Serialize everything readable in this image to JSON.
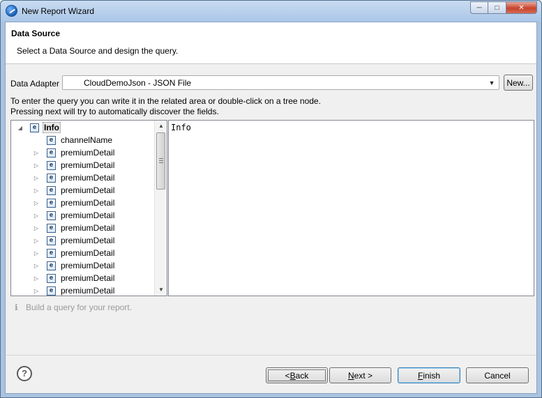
{
  "window": {
    "title": "New Report Wizard",
    "controls": [
      "minimize-icon",
      "maximize-icon",
      "close-icon"
    ]
  },
  "header": {
    "title": "Data Source",
    "description": "Select a Data Source and design the query."
  },
  "adapter": {
    "label": "Data Adapter",
    "selected": "CloudDemoJson - JSON File",
    "new_button": "New..."
  },
  "help": {
    "line1": "To enter the query you can write it in the related area or double-click on a tree node.",
    "line2": "Pressing next will try to automatically discover the fields."
  },
  "tree": {
    "icon_letter": "e",
    "root": "Info",
    "children": [
      {
        "label": "channelName",
        "expandable": false
      },
      {
        "label": "premiumDetail",
        "expandable": true
      },
      {
        "label": "premiumDetail",
        "expandable": true
      },
      {
        "label": "premiumDetail",
        "expandable": true
      },
      {
        "label": "premiumDetail",
        "expandable": true
      },
      {
        "label": "premiumDetail",
        "expandable": true
      },
      {
        "label": "premiumDetail",
        "expandable": true
      },
      {
        "label": "premiumDetail",
        "expandable": true
      },
      {
        "label": "premiumDetail",
        "expandable": true
      },
      {
        "label": "premiumDetail",
        "expandable": true
      },
      {
        "label": "premiumDetail",
        "expandable": true
      },
      {
        "label": "premiumDetail",
        "expandable": true
      },
      {
        "label": "premiumDetail",
        "expandable": true
      }
    ]
  },
  "query": {
    "text": "Info"
  },
  "status": {
    "icon": "info-icon",
    "text": "Build a query for your report."
  },
  "footer": {
    "help_icon": "?",
    "back": {
      "prefix": "< ",
      "mnemonic": "B",
      "rest": "ack"
    },
    "next": {
      "mnemonic": "N",
      "rest": "ext >"
    },
    "finish": {
      "mnemonic": "F",
      "rest": "inish"
    },
    "cancel": "Cancel"
  },
  "colors": {
    "titlebar": "#aac6e8",
    "client_bg": "#f0f0f0",
    "status_text": "#9a9a9a",
    "default_button_border": "#3c7fb1"
  }
}
